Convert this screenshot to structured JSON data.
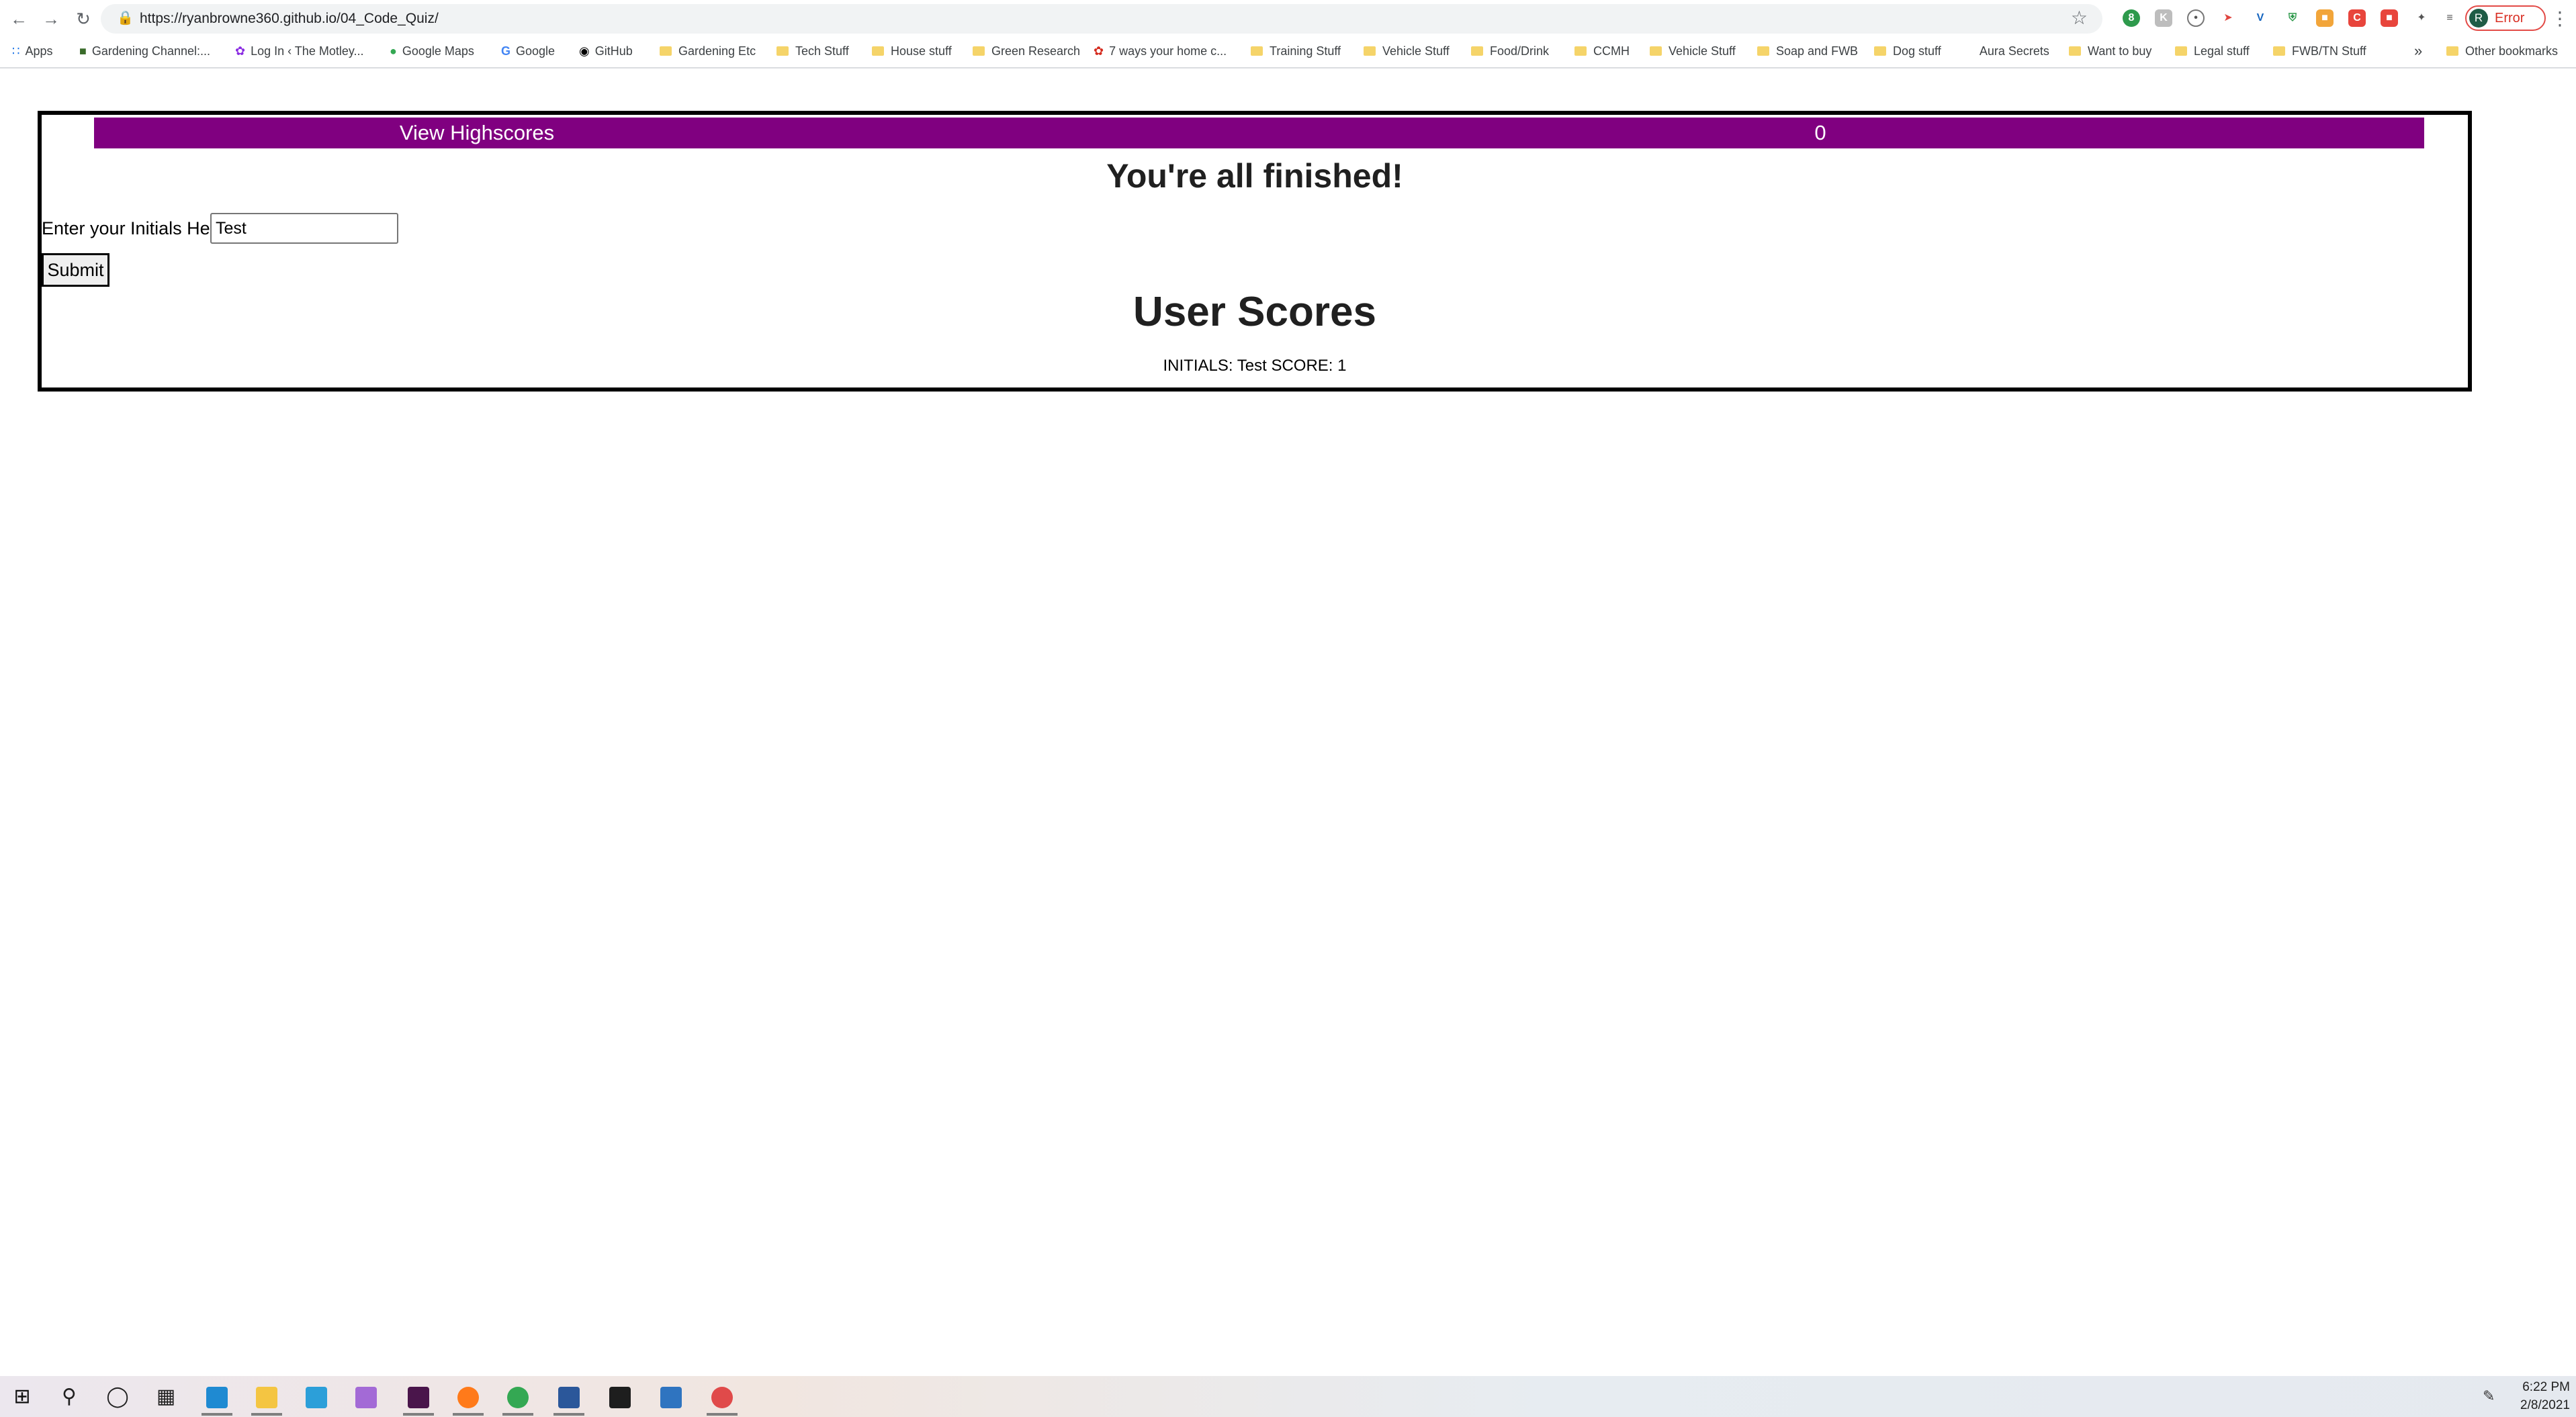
{
  "browser": {
    "url": "https://ryanbrowne360.github.io/04_Code_Quiz/",
    "profile_initial": "R",
    "profile_status": "Error",
    "bookmarks": [
      {
        "label": "Apps",
        "icon": "apps-grid-icon"
      },
      {
        "label": "Gardening Channel:...",
        "icon": "site-icon"
      },
      {
        "label": "Log In ‹ The Motley...",
        "icon": "site-icon"
      },
      {
        "label": "Google Maps",
        "icon": "maps-pin-icon"
      },
      {
        "label": "Google",
        "icon": "google-g-icon"
      },
      {
        "label": "GitHub",
        "icon": "github-icon"
      },
      {
        "label": "Gardening Etc",
        "icon": "folder-icon"
      },
      {
        "label": "Tech Stuff",
        "icon": "folder-icon"
      },
      {
        "label": "House stuff",
        "icon": "folder-icon"
      },
      {
        "label": "Green Research",
        "icon": "folder-icon"
      },
      {
        "label": "7 ways your home c...",
        "icon": "maple-leaf-icon"
      },
      {
        "label": "Training Stuff",
        "icon": "folder-icon"
      },
      {
        "label": "Vehicle Stuff",
        "icon": "folder-icon"
      },
      {
        "label": "Food/Drink",
        "icon": "folder-icon"
      },
      {
        "label": "CCMH",
        "icon": "folder-icon"
      },
      {
        "label": "Vehicle Stuff",
        "icon": "folder-icon"
      },
      {
        "label": "Soap and FWB",
        "icon": "folder-icon"
      },
      {
        "label": "Dog stuff",
        "icon": "folder-icon"
      },
      {
        "label": "Aura Secrets",
        "icon": "site-icon"
      },
      {
        "label": "Want to buy",
        "icon": "folder-icon"
      },
      {
        "label": "Legal stuff",
        "icon": "folder-icon"
      },
      {
        "label": "FWB/TN Stuff",
        "icon": "folder-icon"
      },
      {
        "label": "»",
        "icon": "overflow-icon"
      },
      {
        "label": "Other bookmarks",
        "icon": "folder-icon"
      }
    ]
  },
  "page": {
    "highscores_link": "View Highscores",
    "timer": "0",
    "finished_title": "You're all finished!",
    "initials_label": "Enter your Initials Here:",
    "initials_value": "Test",
    "submit_label": "Submit",
    "scores_title": "User Scores",
    "score_entry": "INITIALS: Test SCORE: 1"
  },
  "colors": {
    "topbar": "#800080",
    "frame_border": "#000000"
  },
  "taskbar": {
    "apps": [
      "windows-start-icon",
      "search-icon",
      "cortana-icon",
      "task-view-icon",
      "vscode-icon",
      "file-explorer-icon",
      "l-app-icon",
      "git-app-icon",
      "slack-icon",
      "firefox-icon",
      "chrome-icon",
      "word-icon",
      "terminal-icon",
      "photos-icon",
      "snip-app-icon"
    ],
    "time": "6:22 PM",
    "date": "2/8/2021"
  }
}
